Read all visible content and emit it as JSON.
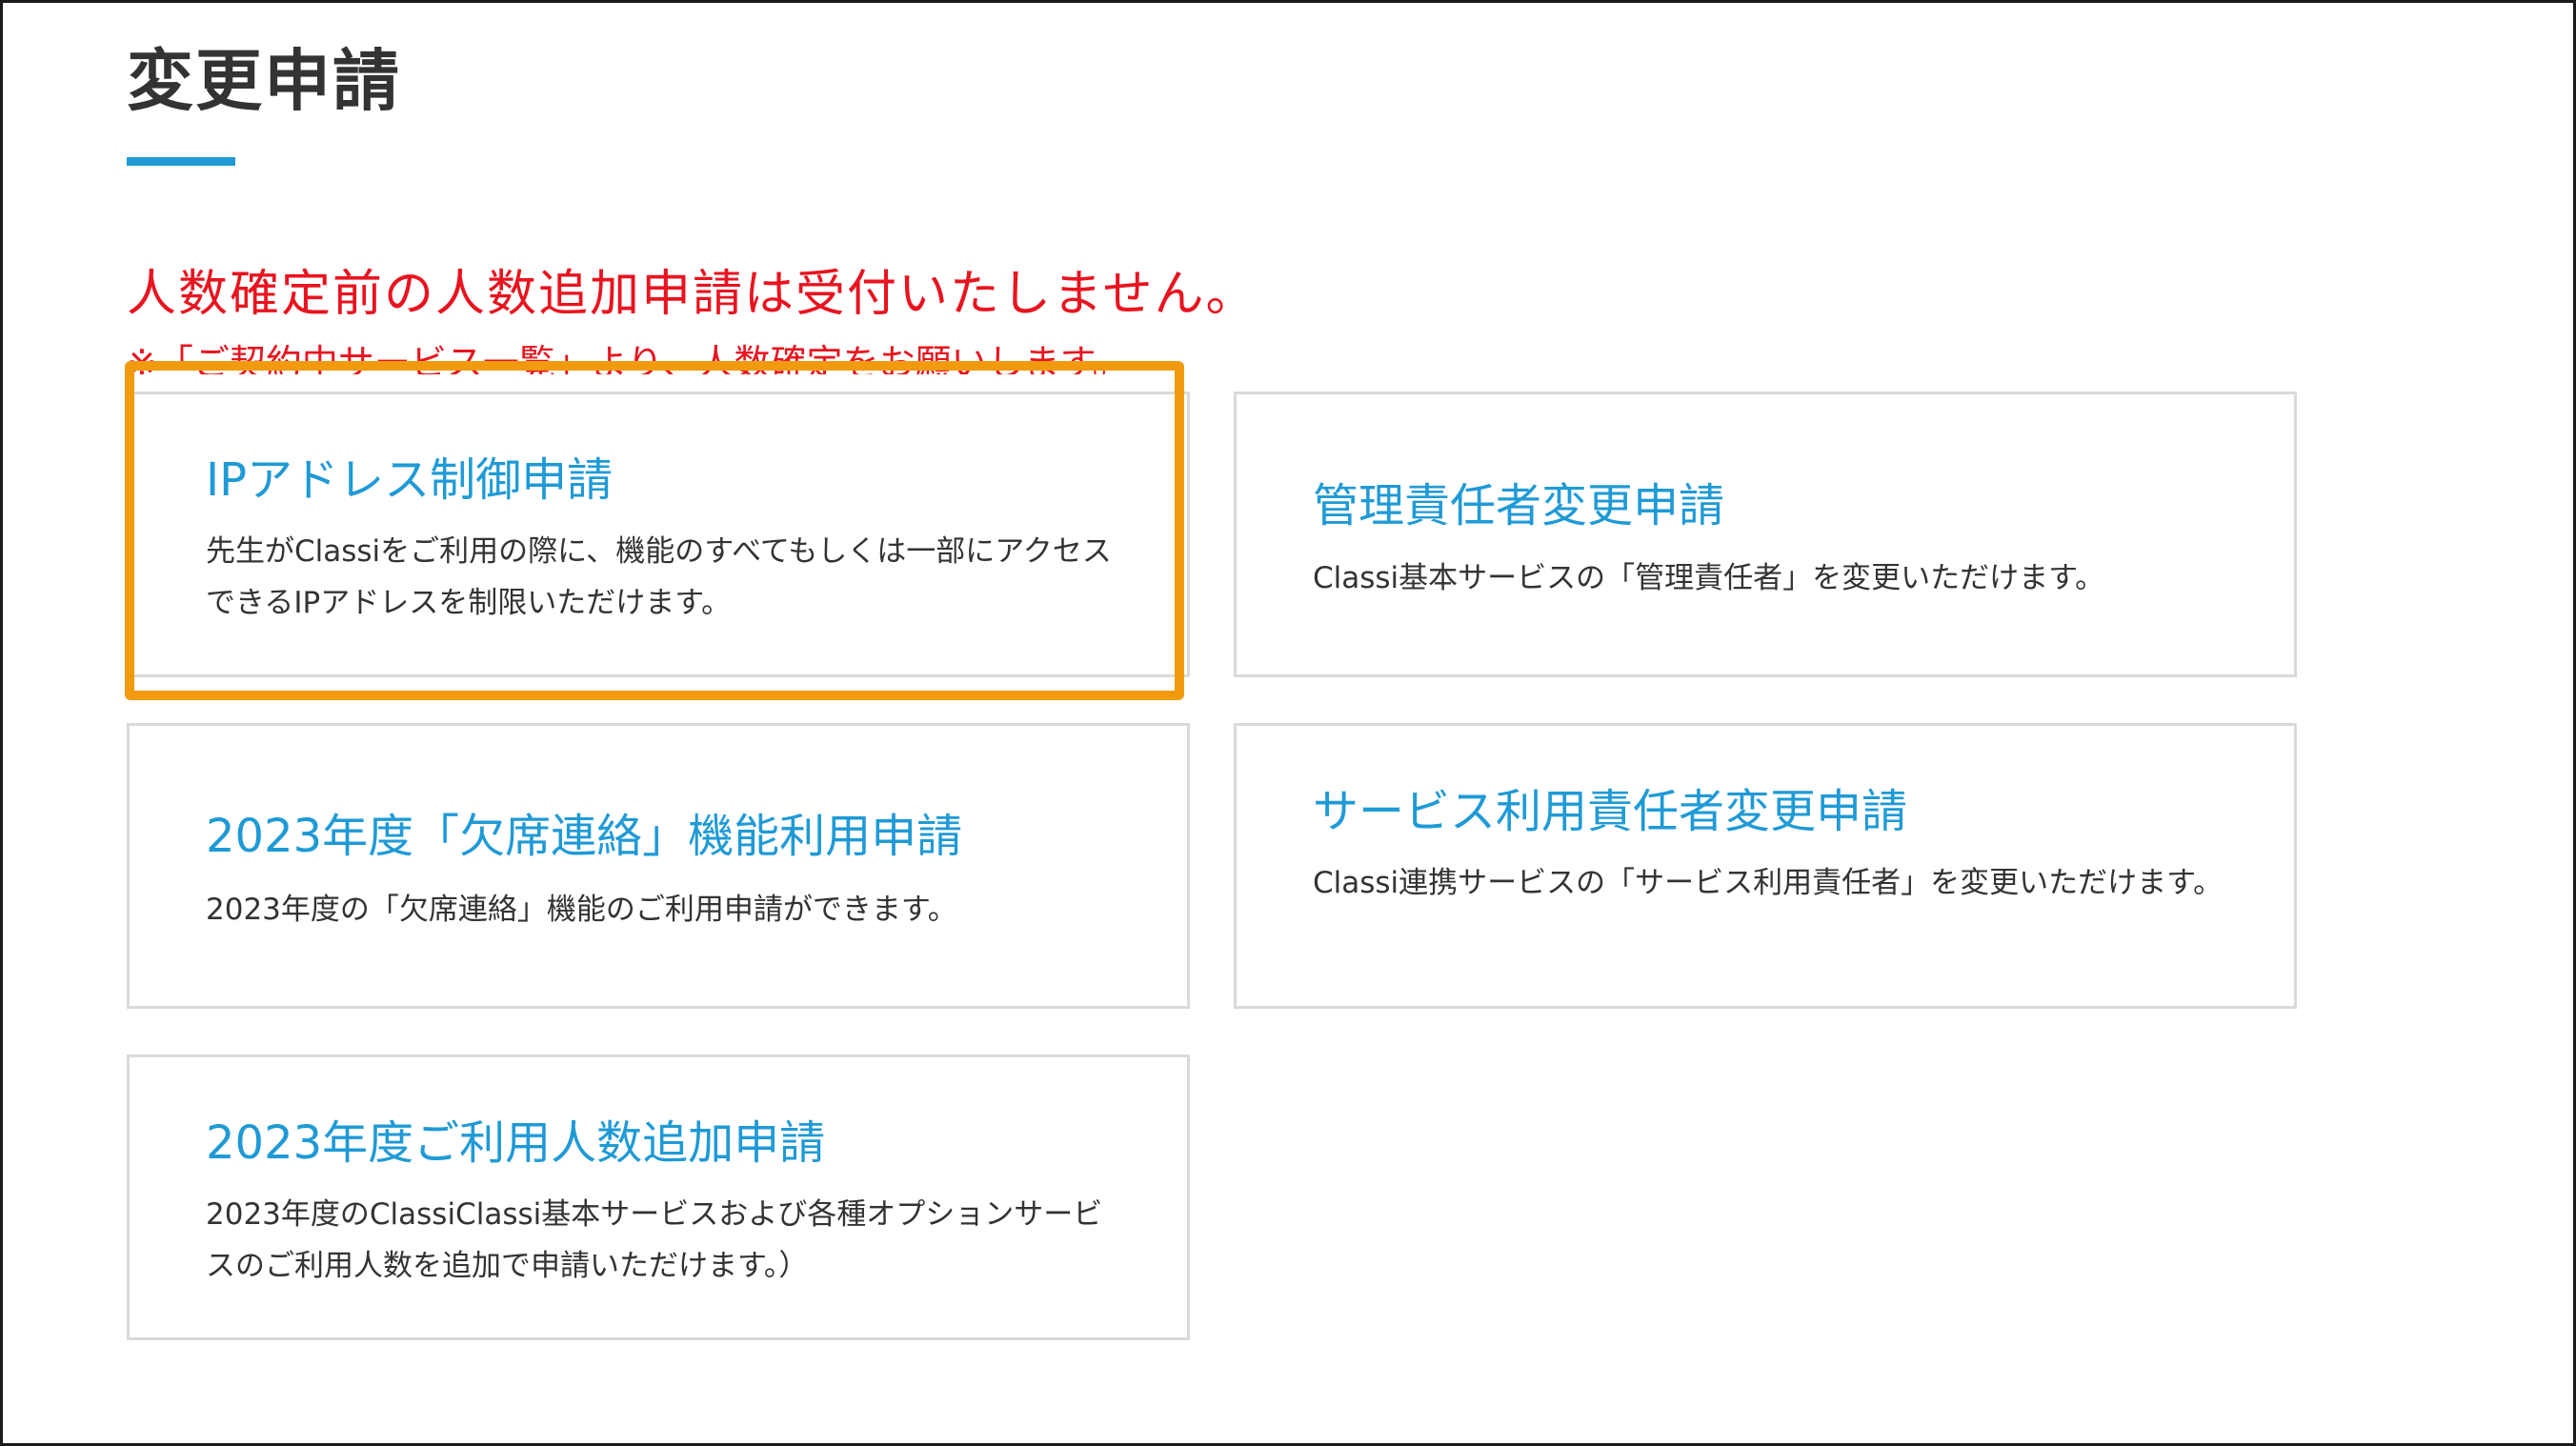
{
  "page": {
    "title": "変更申請"
  },
  "notice": {
    "main": "人数確定前の人数追加申請は受付いたしません。",
    "sub": "※「ご契約中サービス一覧」より、人数確定をお願いします。"
  },
  "cards": [
    {
      "title": "IPアドレス制御申請",
      "description": "先生がClassiをご利用の際に、機能のすべてもしくは一部にアクセスできるIPアドレスを制限いただけます。"
    },
    {
      "title": "管理責任者変更申請",
      "description": "Classi基本サービスの「管理責任者」を変更いただけます。"
    },
    {
      "title": "2023年度「欠席連絡」機能利用申請",
      "description": "2023年度の「欠席連絡」機能のご利用申請ができます。"
    },
    {
      "title": "サービス利用責任者変更申請",
      "description": "Classi連携サービスの「サービス利用責任者」を変更いただけます。"
    },
    {
      "title": "2023年度ご利用人数追加申請",
      "description": "2023年度のClassiClassi基本サービスおよび各種オプションサービスのご利用人数を追加で申請いただけます。）"
    }
  ],
  "colors": {
    "accent": "#1f9ad6",
    "warning": "#e8141f",
    "highlight": "#f29a0e"
  }
}
